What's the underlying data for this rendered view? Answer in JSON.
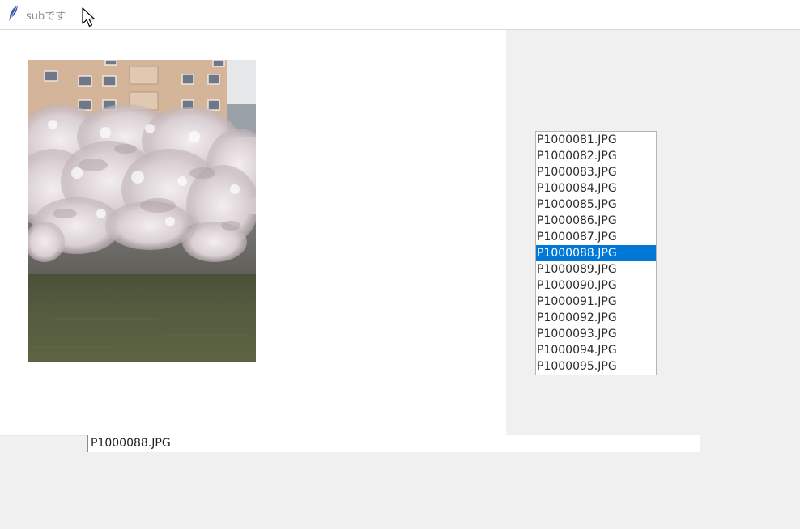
{
  "window": {
    "title": "subです",
    "icon": "feather-icon"
  },
  "photo": {
    "description_icon": "cherry-blossom-photo"
  },
  "file_list": {
    "items": [
      "P1000081.JPG",
      "P1000082.JPG",
      "P1000083.JPG",
      "P1000084.JPG",
      "P1000085.JPG",
      "P1000086.JPG",
      "P1000087.JPG",
      "P1000088.JPG",
      "P1000089.JPG",
      "P1000090.JPG",
      "P1000091.JPG",
      "P1000092.JPG",
      "P1000093.JPG",
      "P1000094.JPG",
      "P1000095.JPG"
    ],
    "selected": "P1000088.JPG"
  },
  "entry": {
    "value": "P1000088.JPG"
  },
  "colors": {
    "selection": "#0078d7",
    "window_bg": "#f0f0f0"
  }
}
